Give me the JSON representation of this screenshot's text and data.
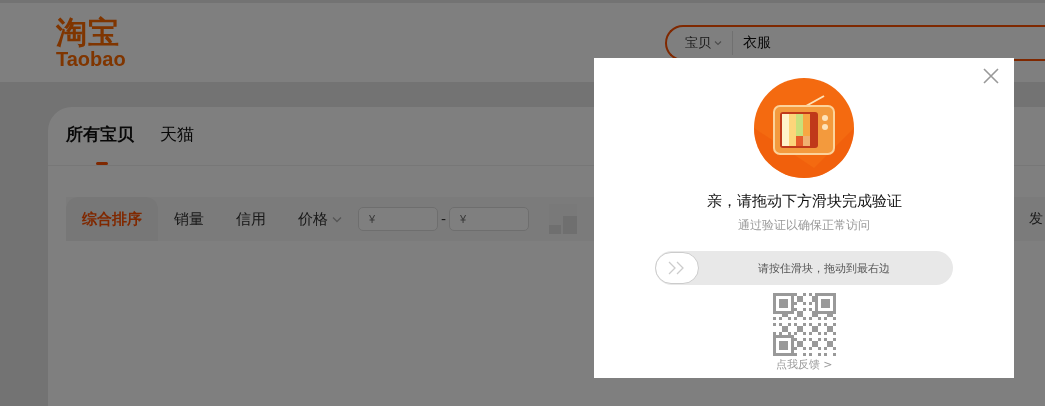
{
  "header": {
    "logo": {
      "mark": "淘宝",
      "wordmark": "Taobao"
    },
    "search": {
      "category": "宝贝",
      "query": "衣服"
    }
  },
  "tabs": [
    {
      "label": "所有宝贝",
      "selected": true
    },
    {
      "label": "天猫",
      "selected": false
    }
  ],
  "sort_options": [
    {
      "label": "综合排序",
      "selected": true,
      "dropdown": false
    },
    {
      "label": "销量",
      "selected": false,
      "dropdown": false
    },
    {
      "label": "信用",
      "selected": false,
      "dropdown": false
    },
    {
      "label": "价格",
      "selected": false,
      "dropdown": true
    }
  ],
  "price_filter": {
    "min_placeholder": "¥",
    "max_placeholder": "¥",
    "separator": "-"
  },
  "cut_text": "发",
  "dialog": {
    "title": "亲，请拖动下方滑块完成验证",
    "subtitle": "通过验证以确保正常访问",
    "slider": {
      "hint": "请按住滑块，拖动到最右边",
      "level": 0
    },
    "feedback_link": "点我反馈 >"
  }
}
